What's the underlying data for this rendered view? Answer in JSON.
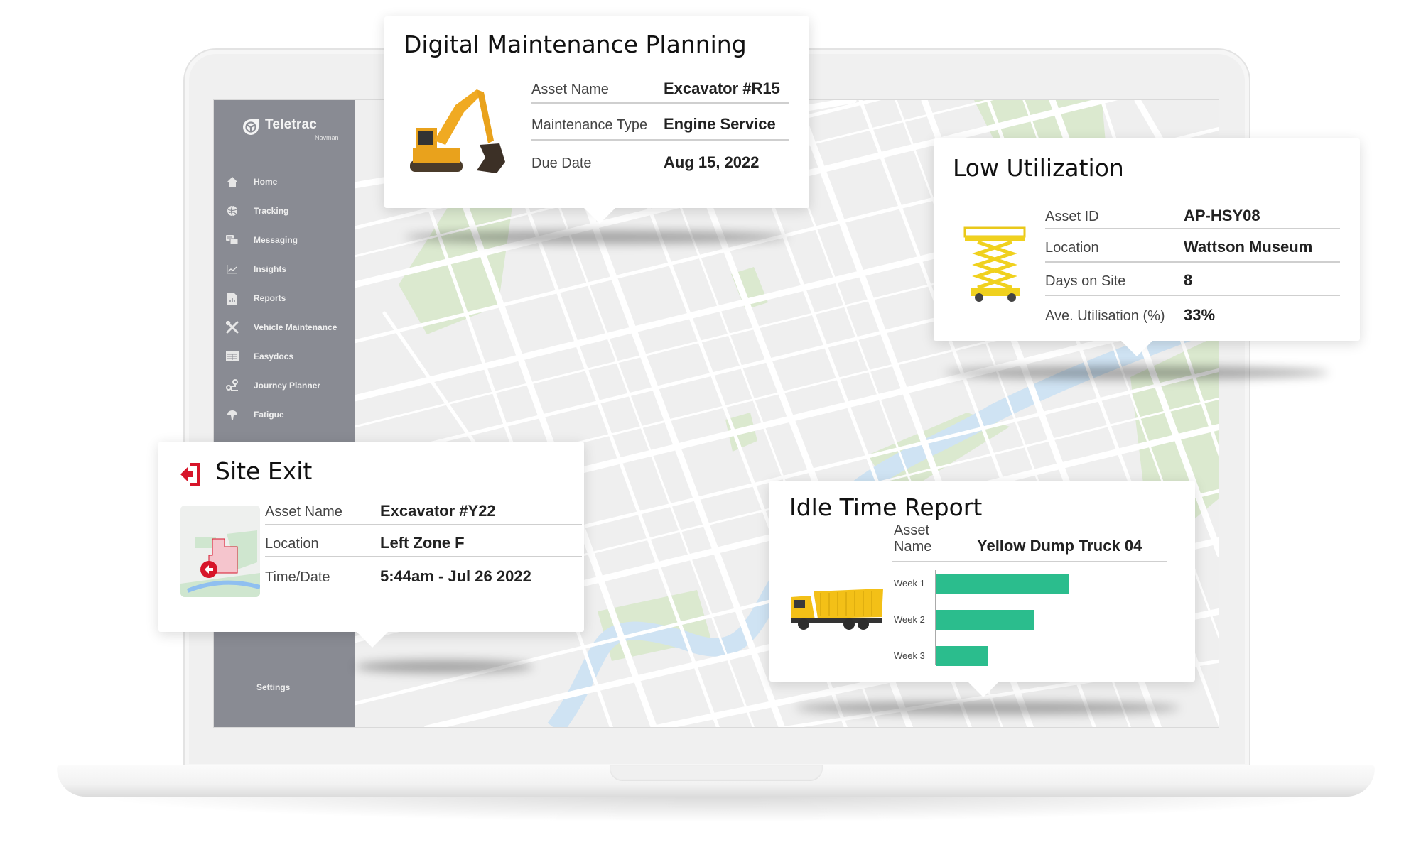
{
  "app": {
    "brand": "Teletrac",
    "brand_sub": "Navman"
  },
  "sidebar": {
    "items": [
      {
        "label": "Home",
        "icon": "home-icon"
      },
      {
        "label": "Tracking",
        "icon": "globe-icon"
      },
      {
        "label": "Messaging",
        "icon": "chat-icon"
      },
      {
        "label": "Insights",
        "icon": "trend-chart-icon"
      },
      {
        "label": "Reports",
        "icon": "report-document-icon"
      },
      {
        "label": "Vehicle Maintenance",
        "icon": "wrench-screwdriver-icon"
      },
      {
        "label": "Easydocs",
        "icon": "document-list-icon"
      },
      {
        "label": "Journey Planner",
        "icon": "route-pin-icon"
      },
      {
        "label": "Fatigue",
        "icon": "steering-wheel-icon"
      }
    ],
    "settings_label": "Settings"
  },
  "cards": {
    "maintenance": {
      "title": "Digital Maintenance Planning",
      "image": "excavator-image",
      "rows": [
        {
          "label": "Asset Name",
          "value": "Excavator #R15"
        },
        {
          "label": "Maintenance Type",
          "value": "Engine Service"
        },
        {
          "label": "Due Date",
          "value": "Aug 15, 2022"
        }
      ]
    },
    "utilization": {
      "title": "Low Utilization",
      "image": "scissor-lift-image",
      "rows": [
        {
          "label": "Asset ID",
          "value": "AP-HSY08"
        },
        {
          "label": "Location",
          "value": "Wattson Museum"
        },
        {
          "label": "Days on Site",
          "value": "8"
        },
        {
          "label": "Ave. Utilisation (%)",
          "value": "33%"
        }
      ]
    },
    "site_exit": {
      "title": "Site Exit",
      "icon": "exit-door-icon",
      "accent": "#d7152a",
      "image": "geofence-map-thumbnail",
      "rows": [
        {
          "label": "Asset Name",
          "value": "Excavator #Y22"
        },
        {
          "label": "Location",
          "value": "Left Zone F"
        },
        {
          "label": "Time/Date",
          "value": "5:44am - Jul 26 2022"
        }
      ]
    },
    "idle": {
      "title": "Idle Time Report",
      "image": "dump-truck-image",
      "asset_label": "Asset Name",
      "asset_value": "Yellow Dump Truck 04",
      "bar_color": "#2bbd8d"
    }
  },
  "chart_data": {
    "type": "bar",
    "orientation": "horizontal",
    "title": "Idle Time Report",
    "categories": [
      "Week 1",
      "Week 2",
      "Week 3"
    ],
    "values": [
      100,
      74,
      39
    ],
    "units": "relative (no axis scale shown)",
    "xlabel": "",
    "ylabel": "",
    "grid": false,
    "legend": "none"
  },
  "colors": {
    "sidebar_bg": "#898b93",
    "map_bg": "#efefef",
    "map_road": "#ffffff",
    "map_park": "#dbe9cf",
    "map_water": "#cfe3f3",
    "bar": "#2bbd8d",
    "exit_red": "#d7152a"
  }
}
